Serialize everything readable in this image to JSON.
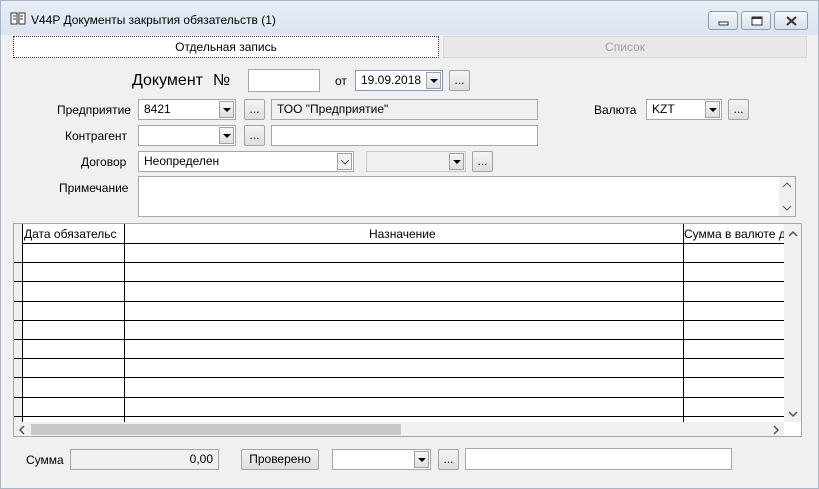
{
  "window": {
    "title": "V44P Документы закрытия обязательств (1)"
  },
  "tabs": {
    "single": "Отдельная запись",
    "list": "Список"
  },
  "header": {
    "doc_label": "Документ",
    "num_label": "№",
    "doc_number": "",
    "from_label": "от",
    "date": "19.09.2018",
    "ellipsis": "..."
  },
  "fields": {
    "enterprise_label": "Предприятие",
    "enterprise_code": "8421",
    "enterprise_name": "ТОО  \"Предприятие\"",
    "currency_label": "Валюта",
    "currency": "KZT",
    "counterparty_label": "Контрагент",
    "counterparty_code": "",
    "counterparty_name": "",
    "contract_label": "Договор",
    "contract": "Неопределен",
    "contract_extra": "",
    "note_label": "Примечание",
    "note": ""
  },
  "grid": {
    "columns": [
      "Дата обязательс",
      "Назначение",
      "Сумма в валюте д"
    ],
    "rows": [
      [
        "",
        "",
        ""
      ],
      [
        "",
        "",
        ""
      ],
      [
        "",
        "",
        ""
      ],
      [
        "",
        "",
        ""
      ],
      [
        "",
        "",
        ""
      ],
      [
        "",
        "",
        ""
      ],
      [
        "",
        "",
        ""
      ],
      [
        "",
        "",
        ""
      ],
      [
        "",
        "",
        ""
      ]
    ]
  },
  "footer": {
    "sum_label": "Сумма",
    "sum_value": "0,00",
    "checked_button": "Проверено",
    "status_select": "",
    "status_text": ""
  },
  "colors": {
    "titlebar": "#dbe4f0",
    "window_bg": "#f0f0f0",
    "grid_lines": "#000000"
  }
}
